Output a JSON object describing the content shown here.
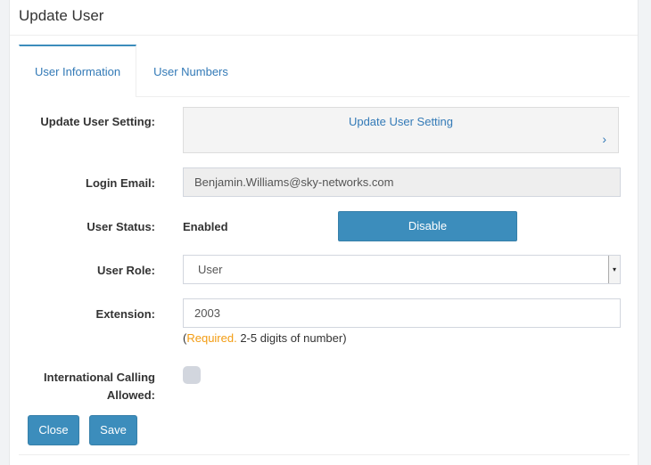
{
  "panel": {
    "title": "Update User"
  },
  "tabs": [
    {
      "label": "User Information",
      "active": true
    },
    {
      "label": "User Numbers",
      "active": false
    }
  ],
  "form": {
    "setting": {
      "label": "Update User Setting:",
      "link_text": "Update User Setting",
      "chevron": "›"
    },
    "email": {
      "label": "Login Email:",
      "value": "Benjamin.Williams@sky-networks.com"
    },
    "status": {
      "label": "User Status:",
      "value": "Enabled",
      "button": "Disable"
    },
    "role": {
      "label": "User Role:",
      "value": "User"
    },
    "extension": {
      "label": "Extension:",
      "value": "2003",
      "help_open": "(",
      "help_required": "Required.",
      "help_rest": " 2-5 digits of number)"
    },
    "intl": {
      "label_line1": "International Calling",
      "label_line2": "Allowed:",
      "enabled": false
    }
  },
  "actions": {
    "close": "Close",
    "save": "Save"
  },
  "colors": {
    "primary": "#3c8dbc",
    "link": "#337ab7",
    "required": "#f39c12"
  }
}
